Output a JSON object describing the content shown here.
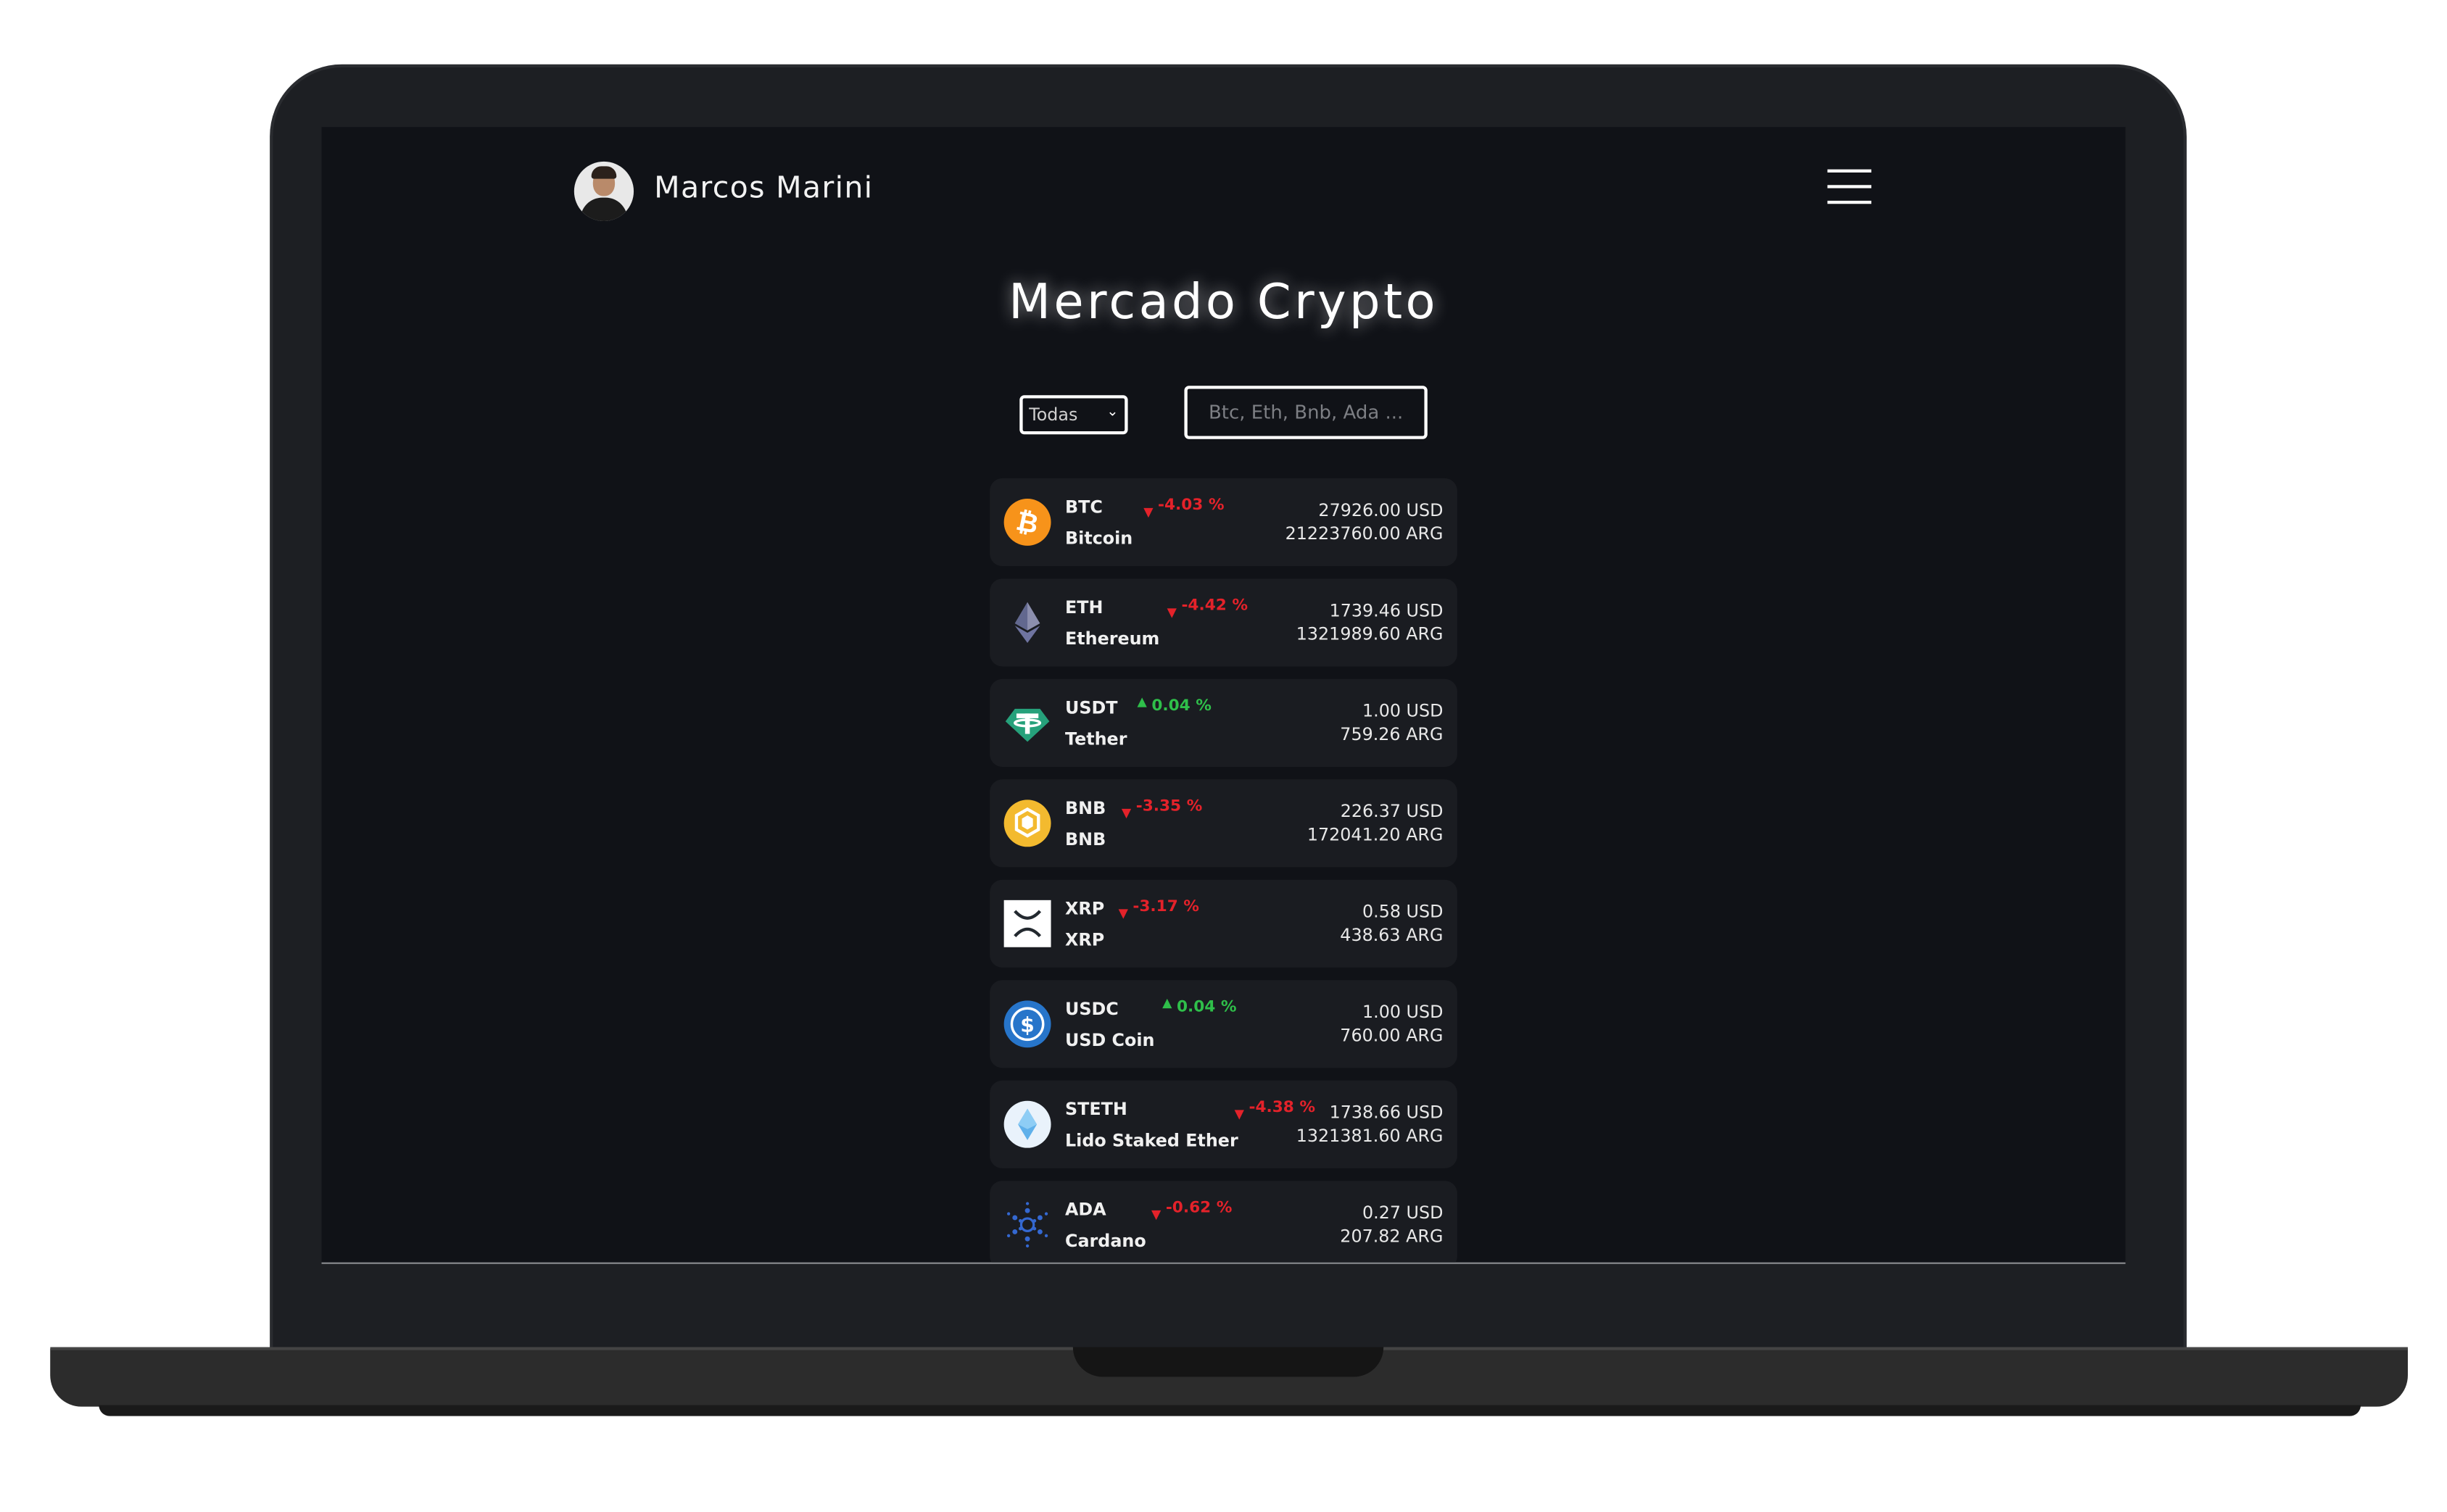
{
  "header": {
    "user_name": "Marcos Marini"
  },
  "title": "Mercado Crypto",
  "filters": {
    "select_value": "Todas",
    "search_placeholder": "Btc, Eth, Bnb, Ada ..."
  },
  "colors": {
    "background": "#101217",
    "row": "#1a1c21",
    "down": "#e4222a",
    "up": "#2fbf4a"
  },
  "coins": [
    {
      "symbol": "BTC",
      "name": "Bitcoin",
      "change": "-4.03 %",
      "direction": "down",
      "usd": "27926.00 USD",
      "ars": "21223760.00 ARG",
      "icon": "bitcoin-icon"
    },
    {
      "symbol": "ETH",
      "name": "Ethereum",
      "change": "-4.42 %",
      "direction": "down",
      "usd": "1739.46 USD",
      "ars": "1321989.60 ARG",
      "icon": "ethereum-icon"
    },
    {
      "symbol": "USDT",
      "name": "Tether",
      "change": "0.04 %",
      "direction": "up",
      "usd": "1.00 USD",
      "ars": "759.26 ARG",
      "icon": "tether-icon"
    },
    {
      "symbol": "BNB",
      "name": "BNB",
      "change": "-3.35 %",
      "direction": "down",
      "usd": "226.37 USD",
      "ars": "172041.20 ARG",
      "icon": "bnb-icon"
    },
    {
      "symbol": "XRP",
      "name": "XRP",
      "change": "-3.17 %",
      "direction": "down",
      "usd": "0.58 USD",
      "ars": "438.63 ARG",
      "icon": "xrp-icon"
    },
    {
      "symbol": "USDC",
      "name": "USD Coin",
      "change": "0.04 %",
      "direction": "up",
      "usd": "1.00 USD",
      "ars": "760.00 ARG",
      "icon": "usdc-icon"
    },
    {
      "symbol": "STETH",
      "name": "Lido Staked Ether",
      "change": "-4.38 %",
      "direction": "down",
      "usd": "1738.66 USD",
      "ars": "1321381.60 ARG",
      "icon": "lido-icon"
    },
    {
      "symbol": "ADA",
      "name": "Cardano",
      "change": "-0.62 %",
      "direction": "down",
      "usd": "0.27 USD",
      "ars": "207.82 ARG",
      "icon": "cardano-icon"
    }
  ]
}
